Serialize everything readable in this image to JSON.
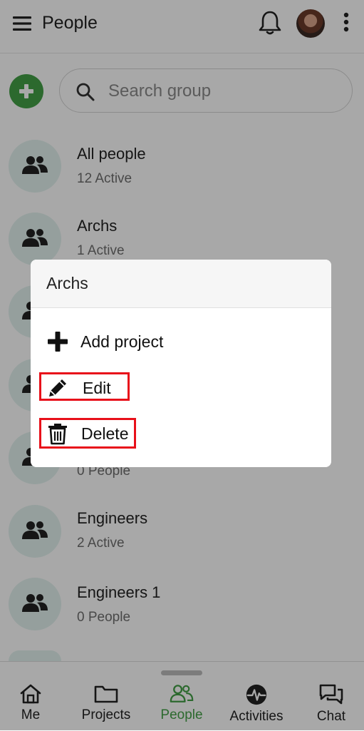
{
  "header": {
    "title": "People",
    "menu_icon": "hamburger-menu-icon",
    "notification_icon": "bell-icon",
    "more_icon": "more-vertical-icon"
  },
  "search": {
    "placeholder": "Search group",
    "value": ""
  },
  "groups": [
    {
      "name": "All people",
      "subtitle": "12 Active"
    },
    {
      "name": "Archs",
      "subtitle": "1 Active"
    },
    {
      "name": "",
      "subtitle": ""
    },
    {
      "name": "",
      "subtitle": ""
    },
    {
      "name": "",
      "subtitle": "0 People"
    },
    {
      "name": "Engineers",
      "subtitle": "2 Active"
    },
    {
      "name": "Engineers 1",
      "subtitle": "0 People"
    }
  ],
  "dialog": {
    "title": "Archs",
    "items": [
      {
        "label": "Add project",
        "icon": "plus-icon"
      },
      {
        "label": "Edit",
        "icon": "pencil-icon"
      },
      {
        "label": "Delete",
        "icon": "trash-icon"
      }
    ]
  },
  "bottom_nav": [
    {
      "label": "Me",
      "icon": "home-icon",
      "active": false
    },
    {
      "label": "Projects",
      "icon": "folder-icon",
      "active": false
    },
    {
      "label": "People",
      "icon": "people-icon",
      "active": true
    },
    {
      "label": "Activities",
      "icon": "activity-icon",
      "active": false
    },
    {
      "label": "Chat",
      "icon": "chat-icon",
      "active": false
    }
  ],
  "colors": {
    "accent": "#43a047",
    "highlight": "#e8101a",
    "group_avatar_bg": "#e2f2ef"
  }
}
